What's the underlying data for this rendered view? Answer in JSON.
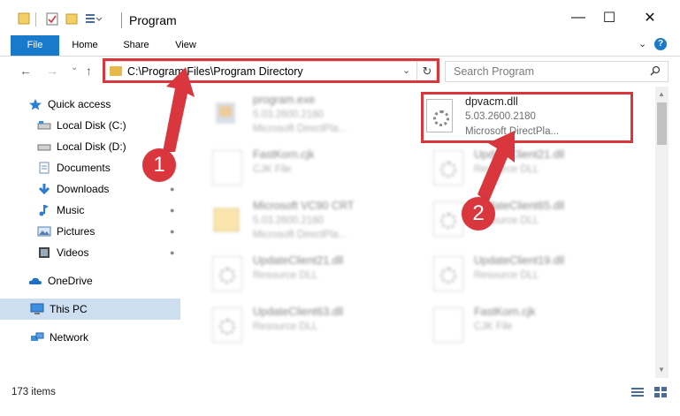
{
  "window": {
    "title": "Program",
    "minimize_glyph": "—",
    "maximize_glyph": "☐",
    "close_glyph": "✕"
  },
  "ribbon": {
    "tabs": [
      "File",
      "Home",
      "Share",
      "View"
    ],
    "collapse_glyph": "⌄",
    "help_glyph": "?"
  },
  "nav": {
    "back_glyph": "←",
    "forward_glyph": "→",
    "recent_glyph": "⌄",
    "up_glyph": "↑"
  },
  "address": {
    "path": "C:\\Program Files\\Program Directory",
    "dropdown_glyph": "⌄",
    "refresh_glyph": "↻"
  },
  "search": {
    "placeholder": "Search Program"
  },
  "sidebar": {
    "items": [
      {
        "label": "Quick access",
        "icon": "star-icon"
      },
      {
        "label": "Local Disk (C:)",
        "icon": "drive-icon"
      },
      {
        "label": "Local Disk (D:)",
        "icon": "drive-icon"
      },
      {
        "label": "Documents",
        "icon": "documents-icon"
      },
      {
        "label": "Downloads",
        "icon": "downloads-icon"
      },
      {
        "label": "Music",
        "icon": "music-icon"
      },
      {
        "label": "Pictures",
        "icon": "pictures-icon"
      },
      {
        "label": "Videos",
        "icon": "videos-icon"
      },
      {
        "label": "OneDrive",
        "icon": "cloud-icon"
      },
      {
        "label": "This PC",
        "icon": "pc-icon"
      },
      {
        "label": "Network",
        "icon": "network-icon"
      }
    ],
    "pin_glyph": "📌"
  },
  "files": [
    {
      "name": "program.exe",
      "line1": "5.03.2600.2180",
      "line2": "Microsoft DirectPla...",
      "kind": "exe",
      "blurred": true
    },
    {
      "name": "dpvacm.dll",
      "line1": "5.03.2600.2180",
      "line2": "Microsoft DirectPla...",
      "kind": "dll",
      "blurred": false
    },
    {
      "name": "FastKorn.cjk",
      "line1": "CJK File",
      "line2": "",
      "kind": "doc",
      "blurred": true
    },
    {
      "name": "UpdateClient21.dll",
      "line1": "Resource DLL",
      "line2": "",
      "kind": "dll",
      "blurred": true
    },
    {
      "name": "Microsoft VC90 CRT",
      "line1": "5.03.2600.2180",
      "line2": "Microsoft DirectPla...",
      "kind": "folder",
      "blurred": true
    },
    {
      "name": "UpdateClient65.dll",
      "line1": "Resource DLL",
      "line2": "",
      "kind": "dll",
      "blurred": true
    },
    {
      "name": "UpdateClient21.dll",
      "line1": "Resource DLL",
      "line2": "",
      "kind": "dll",
      "blurred": true
    },
    {
      "name": "UpdateClient19.dll",
      "line1": "Resource DLL",
      "line2": "",
      "kind": "dll",
      "blurred": true
    },
    {
      "name": "UpdateClient63.dll",
      "line1": "Resource DLL",
      "line2": "",
      "kind": "dll",
      "blurred": true
    },
    {
      "name": "FastKorn.cjk",
      "line1": "CJK File",
      "line2": "",
      "kind": "doc",
      "blurred": true
    }
  ],
  "status": {
    "item_count": "173 items"
  },
  "callouts": [
    "1",
    "2"
  ],
  "colors": {
    "accent": "#1979ca",
    "highlight": "#d9363e",
    "selected": "#ccdef0"
  }
}
